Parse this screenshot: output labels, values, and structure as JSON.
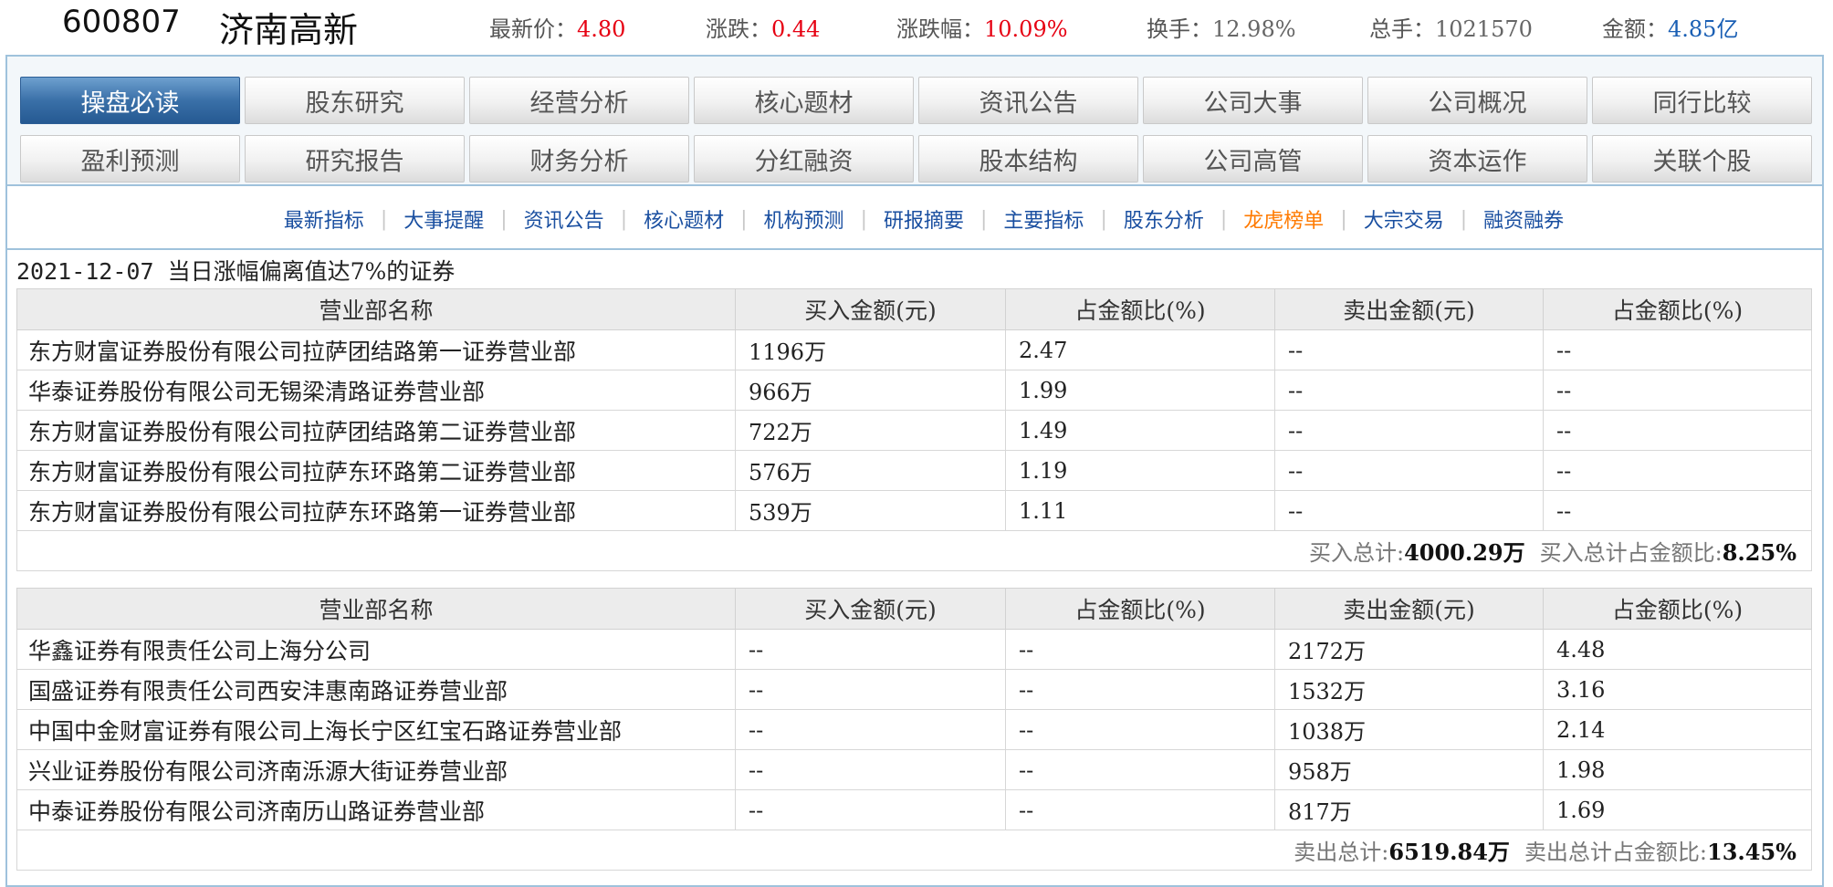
{
  "quote": {
    "code": "600807",
    "name": "济南高新",
    "latest_label": "最新价：",
    "latest": "4.80",
    "change_label": "涨跌：",
    "change": "0.44",
    "pct_label": "涨跌幅：",
    "pct": "10.09%",
    "turnover_label": "换手：",
    "turnover": "12.98%",
    "volume_label": "总手：",
    "volume": "1021570",
    "amount_label": "金额：",
    "amount": "4.85亿"
  },
  "nav": {
    "row1": [
      "操盘必读",
      "股东研究",
      "经营分析",
      "核心题材",
      "资讯公告",
      "公司大事",
      "公司概况",
      "同行比较"
    ],
    "row2": [
      "盈利预测",
      "研究报告",
      "财务分析",
      "分红融资",
      "股本结构",
      "公司高管",
      "资本运作",
      "关联个股"
    ],
    "active": "操盘必读"
  },
  "subnav": [
    "最新指标",
    "大事提醒",
    "资讯公告",
    "核心题材",
    "机构预测",
    "研报摘要",
    "主要指标",
    "股东分析",
    "龙虎榜单",
    "大宗交易",
    "融资融券"
  ],
  "subnav_active": "龙虎榜单",
  "report": {
    "date": "2021-12-07",
    "title": "当日涨幅偏离值达7%的证券"
  },
  "columns": [
    "营业部名称",
    "买入金额(元)",
    "占金额比(%)",
    "卖出金额(元)",
    "占金额比(%)"
  ],
  "buy_table": {
    "rows": [
      [
        "东方财富证券股份有限公司拉萨团结路第一证券营业部",
        "1196万",
        "2.47",
        "--",
        "--"
      ],
      [
        "华泰证券股份有限公司无锡梁清路证券营业部",
        "966万",
        "1.99",
        "--",
        "--"
      ],
      [
        "东方财富证券股份有限公司拉萨团结路第二证券营业部",
        "722万",
        "1.49",
        "--",
        "--"
      ],
      [
        "东方财富证券股份有限公司拉萨东环路第二证券营业部",
        "576万",
        "1.19",
        "--",
        "--"
      ],
      [
        "东方财富证券股份有限公司拉萨东环路第一证券营业部",
        "539万",
        "1.11",
        "--",
        "--"
      ]
    ],
    "total_label": "买入总计:",
    "total_value": "4000.29万",
    "ratio_label": "买入总计占金额比:",
    "ratio_value": "8.25%"
  },
  "sell_table": {
    "rows": [
      [
        "华鑫证券有限责任公司上海分公司",
        "--",
        "--",
        "2172万",
        "4.48"
      ],
      [
        "国盛证券有限责任公司西安沣惠南路证券营业部",
        "--",
        "--",
        "1532万",
        "3.16"
      ],
      [
        "中国中金财富证券有限公司上海长宁区红宝石路证券营业部",
        "--",
        "--",
        "1038万",
        "2.14"
      ],
      [
        "兴业证券股份有限公司济南泺源大街证券营业部",
        "--",
        "--",
        "958万",
        "1.98"
      ],
      [
        "中泰证券股份有限公司济南历山路证券营业部",
        "--",
        "--",
        "817万",
        "1.69"
      ]
    ],
    "total_label": "卖出总计:",
    "total_value": "6519.84万",
    "ratio_label": "卖出总计占金额比:",
    "ratio_value": "13.45%"
  },
  "colors": {
    "up_red": "#e60012",
    "link_blue": "#1a4fa0",
    "active_orange": "#ff7a00",
    "nav_active": "#3a70a8",
    "frame_border": "#9fc2dc"
  }
}
